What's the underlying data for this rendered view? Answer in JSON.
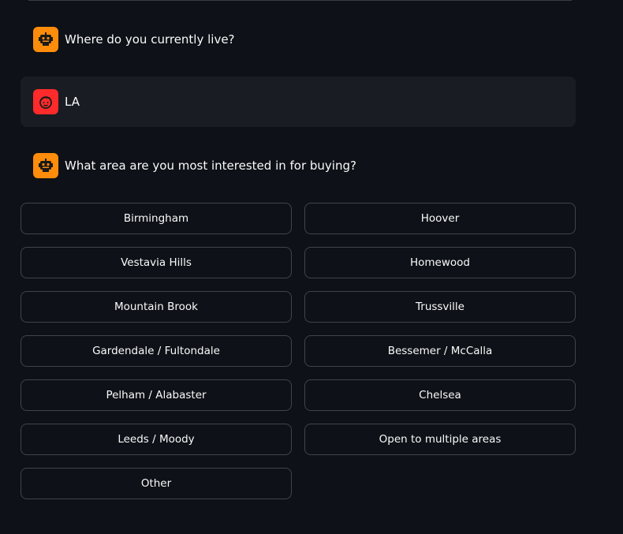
{
  "messages": [
    {
      "role": "assistant",
      "text": "Where do you currently live?"
    },
    {
      "role": "user",
      "text": "LA"
    },
    {
      "role": "assistant",
      "text": "What area are you most interested in for buying?"
    }
  ],
  "options": [
    "Birmingham",
    "Hoover",
    "Vestavia Hills",
    "Homewood",
    "Mountain Brook",
    "Trussville",
    "Gardendale / Fultondale",
    "Bessemer / McCalla",
    "Pelham / Alabaster",
    "Chelsea",
    "Leeds / Moody",
    "Open to multiple areas",
    "Other"
  ],
  "colors": {
    "background": "#0e1117",
    "assistant_avatar": "#ff8c0a",
    "user_avatar": "#ff2b2b",
    "user_bubble": "#1a1c24",
    "button_border": "#41444e"
  },
  "icons": {
    "assistant_avatar": "robot-icon",
    "user_avatar": "smiley-face-icon"
  }
}
